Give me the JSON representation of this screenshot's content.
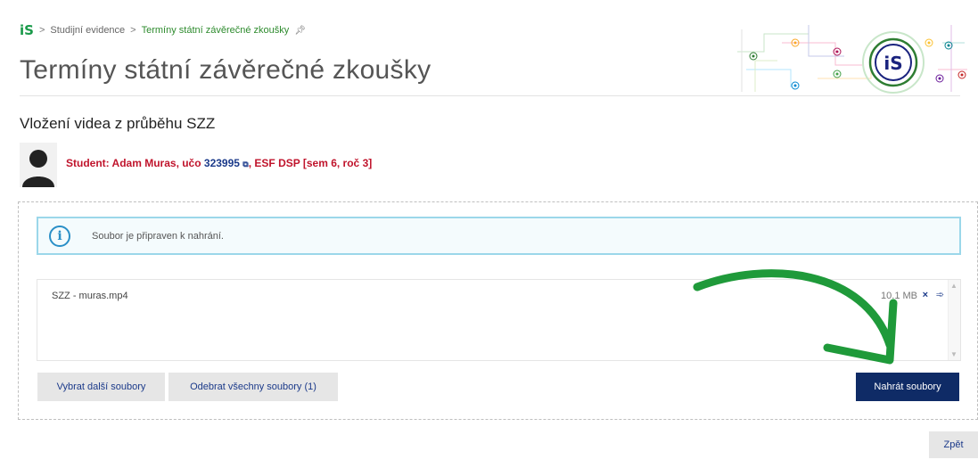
{
  "breadcrumb": {
    "logo": "iS",
    "separator": ">",
    "items": [
      "Studijní evidence",
      "Termíny státní závěrečné zkoušky"
    ]
  },
  "page": {
    "title": "Termíny státní závěrečné zkoušky",
    "section_title": "Vložení videa z průběhu SZZ"
  },
  "student": {
    "prefix": "Student: Adam Muras, učo ",
    "uco": "323995",
    "program": ", ESF DSP [sem 6, roč 3]"
  },
  "info": {
    "icon_glyph": "i",
    "message": "Soubor je připraven k nahrání."
  },
  "files": [
    {
      "name": "SZZ - muras.mp4",
      "size": "10.1 MB",
      "remove_glyph": "×",
      "upload_glyph": "➾"
    }
  ],
  "buttons": {
    "select_more": "Vybrat další soubory",
    "remove_all": "Odebrat všechny soubory (1)",
    "upload": "Nahrát soubory",
    "back": "Zpět"
  },
  "colors": {
    "accent_green": "#1a9a4a",
    "student_red": "#c0142c",
    "link_blue": "#1b3a8a",
    "primary_button": "#0f2b66",
    "info_border": "#9bd7ea",
    "arrow_green": "#1f9a3a"
  }
}
